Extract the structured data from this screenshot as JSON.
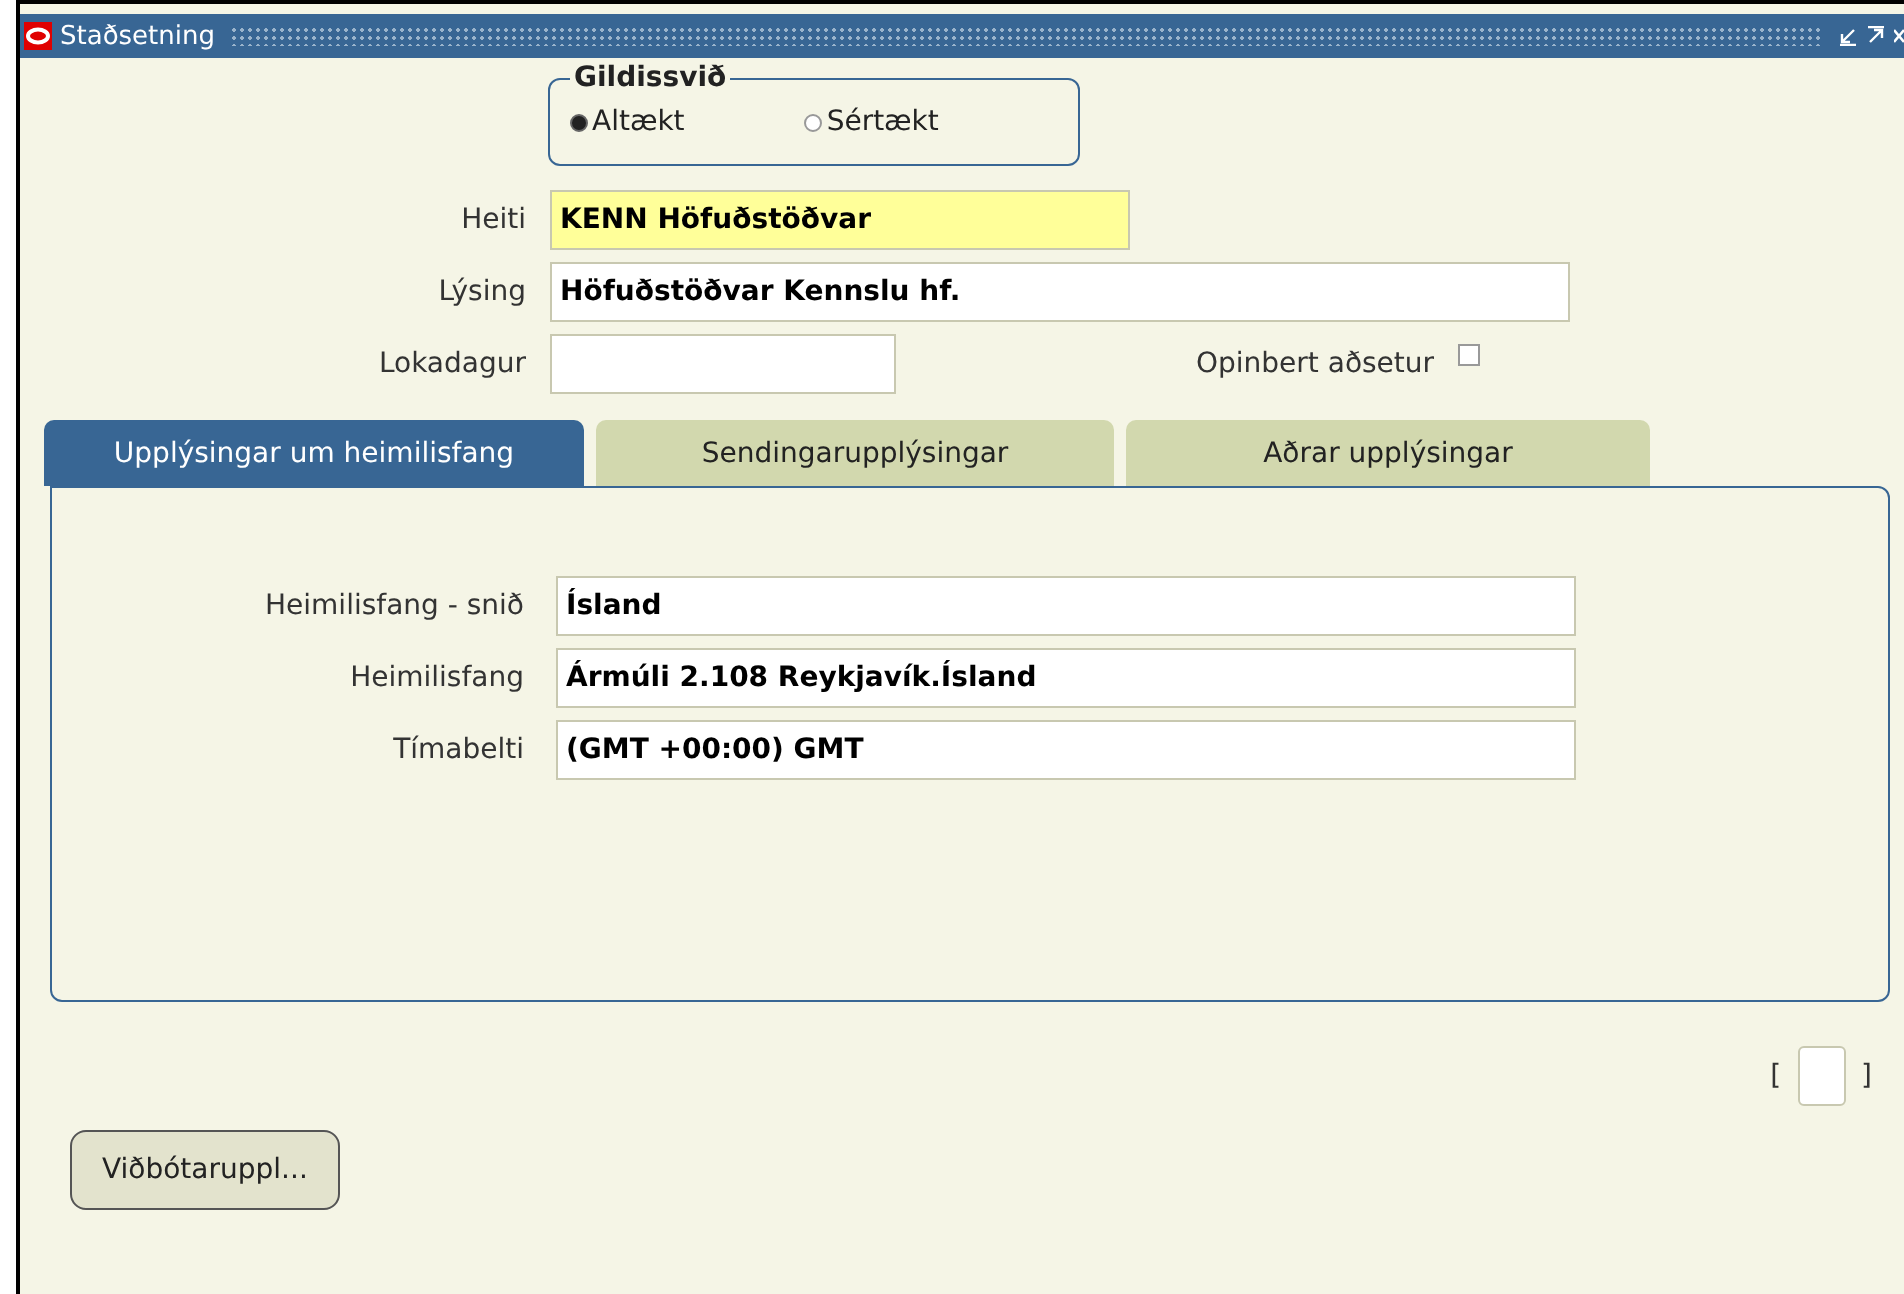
{
  "window": {
    "title": "Staðsetning"
  },
  "scope": {
    "label": "Gildissvið",
    "options": [
      {
        "label": "Altækt",
        "selected": true
      },
      {
        "label": "Sértækt",
        "selected": false
      }
    ]
  },
  "fields": [
    {
      "label": "Heiti",
      "value": "KENN Höfuðstöðvar",
      "required": true
    },
    {
      "label": "Lýsing",
      "value": "Höfuðstöðvar Kennslu hf.",
      "required": false
    }
  ],
  "end_date": {
    "label": "Lokadagur"
  },
  "official_residence": {
    "label": "Opinbert aðsetur",
    "checked": false
  },
  "tabs": [
    {
      "label": "Upplýsingar um heimilisfang",
      "selected": true
    },
    {
      "label": "Sendingarupplýsingar",
      "selected": false
    },
    {
      "label": "Aðrar upplýsingar",
      "selected": false
    }
  ],
  "address_fields": [
    {
      "label": "Heimilisfang - snið",
      "value": "Ísland"
    },
    {
      "label": "Heimilisfang",
      "value": "Ármúli 2.108 Reykjavík.Ísland"
    },
    {
      "label": "Tímabelti",
      "value": "(GMT +00:00) GMT"
    }
  ],
  "bracket": {
    "open": "[",
    "close": "]"
  },
  "buttons": [
    "Viðbótaruppl..."
  ]
}
